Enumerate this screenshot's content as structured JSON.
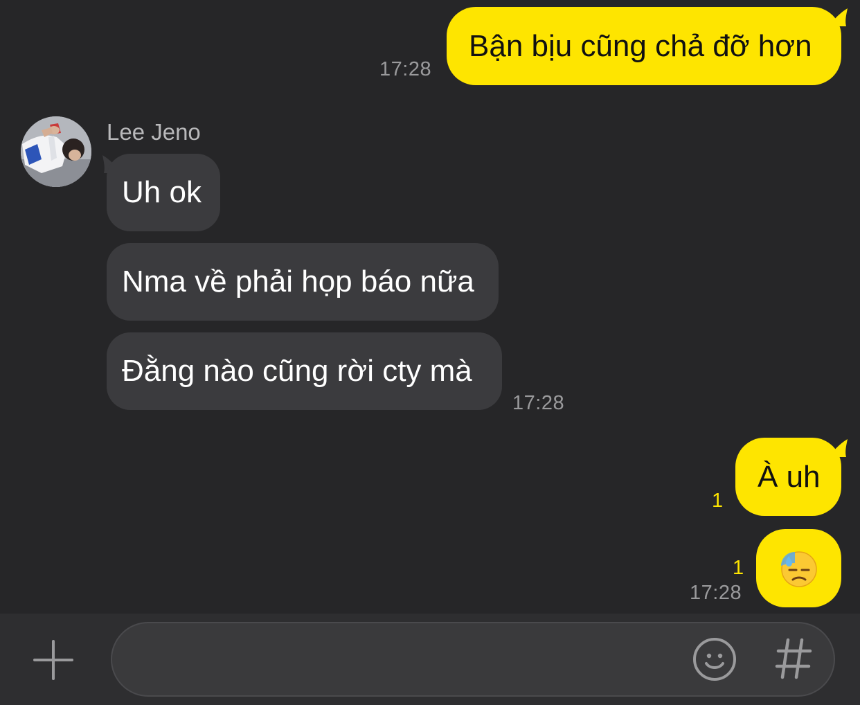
{
  "conversation": {
    "contact": {
      "name": "Lee Jeno"
    },
    "messages": [
      {
        "from": "me",
        "text": "Bận bịu cũng chả đỡ hơn",
        "time": "17:28"
      },
      {
        "from": "them",
        "text": "Uh ok"
      },
      {
        "from": "them",
        "text": "Nma về phải họp báo nữa"
      },
      {
        "from": "them",
        "text": "Đằng nào cũng rời cty mà",
        "time": "17:28"
      },
      {
        "from": "me",
        "text": "À uh",
        "unread": "1"
      },
      {
        "from": "me",
        "emoji": "downcast-face-with-sweat",
        "unread": "1",
        "time": "17:28"
      }
    ]
  },
  "input_bar": {
    "placeholder": "",
    "icons": {
      "add": "plus-icon",
      "emoticon": "smiley-icon",
      "hashtag": "hash-icon"
    }
  },
  "colors": {
    "background": "#262628",
    "my_bubble": "#fee500",
    "their_bubble": "#3b3b3e",
    "unread_count": "#fee500"
  }
}
